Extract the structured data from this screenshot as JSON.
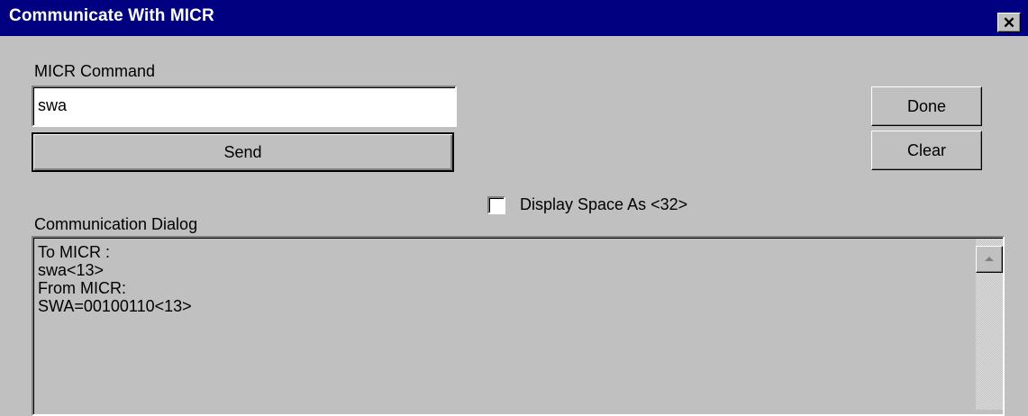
{
  "window": {
    "title": "Communicate With MICR",
    "close_glyph": "✕"
  },
  "micr_command": {
    "label": "MICR Command",
    "value": "swa"
  },
  "buttons": {
    "send": "Send",
    "done": "Done",
    "clear": "Clear"
  },
  "display_space_option": {
    "label": "Display Space As <32>",
    "checked": false
  },
  "communication_dialog": {
    "label": "Communication Dialog",
    "lines": [
      "To MICR :",
      "swa<13>",
      "From MICR:",
      "SWA=00100110<13>"
    ]
  },
  "colors": {
    "titlebar": "#000080",
    "face": "#c0c0c0"
  }
}
